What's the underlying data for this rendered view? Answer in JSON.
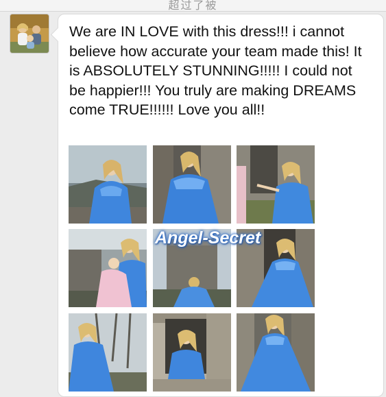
{
  "header": {
    "title": "超过了被"
  },
  "post": {
    "message": "We are IN LOVE with this dress!!! i cannot believe how accurate your team made this! It is ABSOLUTELY STUNNING!!!!! I could not be happier!!! You truly are making DREAMS come TRUE!!!!!! Love you all!!",
    "watermark": "Angel-Secret"
  },
  "colors": {
    "dress_blue": "#4a8fe0",
    "background": "#ececec",
    "bubble": "#ffffff"
  }
}
